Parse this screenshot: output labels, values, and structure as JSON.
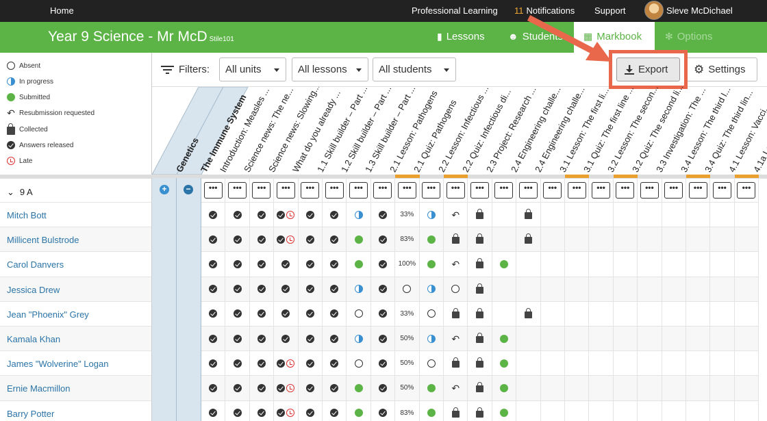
{
  "topnav": {
    "home": "Home",
    "professional_learning": "Professional Learning",
    "notif_count": "11",
    "notifications": "Notifications",
    "support": "Support",
    "user_name": "Sleve McDichael"
  },
  "course": {
    "title": "Year 9 Science - Mr McD",
    "code": "Stile101",
    "tabs": [
      "Lessons",
      "Students",
      "Markbook",
      "Options"
    ]
  },
  "legend": [
    "Absent",
    "In progress",
    "Submitted",
    "Resubmission requested",
    "Collected",
    "Answers released",
    "Late"
  ],
  "filters": {
    "label": "Filters:",
    "units": "All units",
    "lessons": "All lessons",
    "students": "All students",
    "export": "Export",
    "settings": "Settings"
  },
  "units": [
    "Genetics",
    "The Immune System"
  ],
  "columns": [
    "Introduction: Measles ...",
    "Science news: The ne...",
    "Science news: Slowing...",
    "What do you already ...",
    "1.1 Skill builder – Part ...",
    "1.2 Skill builder – Part ...",
    "1.3 Skill builder – Part ...",
    "2.1 Lesson: Pathogens",
    "2.1 Quiz: Pathogens",
    "2.2 Lesson: Infectious ...",
    "2.2 Quiz: Infectious di...",
    "2.3 Project: Research ...",
    "2.4 Engineering challe...",
    "2.4 Engineering challe...",
    "3.1 Lesson: The first li...",
    "3.1 Quiz: The first line ...",
    "3.2 Lesson: The secon...",
    "3.2 Quiz: The second li...",
    "3.3 Investigation: The ...",
    "3.4 Lesson: The third l...",
    "3.4 Quiz: The third lin...",
    "4.1 Lesson: Vacci...",
    "4.1a Les..."
  ],
  "group": "9 A",
  "dots": "•••",
  "students": [
    {
      "name": "Mitch Bott",
      "cells": [
        "chk",
        "chk",
        "chk",
        "chk-late",
        "chk",
        "chk",
        "half",
        "chk",
        "33%",
        "half",
        "resub",
        "lock",
        "",
        "lock",
        "",
        "",
        "",
        "",
        "",
        "",
        "",
        "",
        ""
      ]
    },
    {
      "name": "Millicent Bulstrode",
      "cells": [
        "chk",
        "chk",
        "chk",
        "chk-late",
        "chk",
        "chk",
        "green",
        "chk",
        "83%",
        "green",
        "lock",
        "lock",
        "",
        "lock",
        "",
        "",
        "",
        "",
        "",
        "",
        "",
        "",
        ""
      ]
    },
    {
      "name": "Carol Danvers",
      "cells": [
        "chk",
        "chk",
        "chk",
        "chk",
        "chk",
        "chk",
        "green",
        "chk",
        "100%",
        "green",
        "resub",
        "lock",
        "green",
        "",
        "",
        "",
        "",
        "",
        "",
        "",
        "",
        "",
        ""
      ]
    },
    {
      "name": "Jessica Drew",
      "cells": [
        "chk",
        "chk",
        "chk",
        "chk",
        "chk",
        "chk",
        "half",
        "chk",
        "circ",
        "half",
        "circ",
        "lock",
        "",
        "",
        "",
        "",
        "",
        "",
        "",
        "",
        "",
        "",
        ""
      ]
    },
    {
      "name": "Jean \"Phoenix\" Grey",
      "cells": [
        "chk",
        "chk",
        "chk",
        "chk",
        "chk",
        "chk",
        "circ",
        "chk",
        "33%",
        "circ",
        "lock",
        "lock",
        "",
        "lock",
        "",
        "",
        "",
        "",
        "",
        "",
        "",
        "",
        ""
      ]
    },
    {
      "name": "Kamala Khan",
      "cells": [
        "chk",
        "chk",
        "chk",
        "chk",
        "chk",
        "chk",
        "half",
        "chk",
        "50%",
        "half",
        "resub",
        "lock",
        "green",
        "",
        "",
        "",
        "",
        "",
        "",
        "",
        "",
        "",
        ""
      ]
    },
    {
      "name": "James \"Wolverine\" Logan",
      "cells": [
        "chk",
        "chk",
        "chk",
        "chk-late",
        "chk",
        "chk",
        "circ",
        "chk",
        "50%",
        "circ",
        "lock",
        "lock",
        "green",
        "",
        "",
        "",
        "",
        "",
        "",
        "",
        "",
        "",
        ""
      ]
    },
    {
      "name": "Ernie Macmillon",
      "cells": [
        "chk",
        "chk",
        "chk",
        "chk-late",
        "chk",
        "chk",
        "green",
        "chk",
        "50%",
        "green",
        "resub",
        "lock",
        "green",
        "",
        "",
        "",
        "",
        "",
        "",
        "",
        "",
        "",
        ""
      ]
    },
    {
      "name": "Barry Potter",
      "cells": [
        "chk",
        "chk",
        "chk",
        "chk-late",
        "chk",
        "chk",
        "green",
        "chk",
        "83%",
        "green",
        "lock",
        "lock",
        "green",
        "",
        "",
        "",
        "",
        "",
        "",
        "",
        "",
        "",
        ""
      ]
    }
  ],
  "colors": {
    "brand": "#5cb446",
    "accent": "#e9674a",
    "link": "#2b74a8"
  }
}
